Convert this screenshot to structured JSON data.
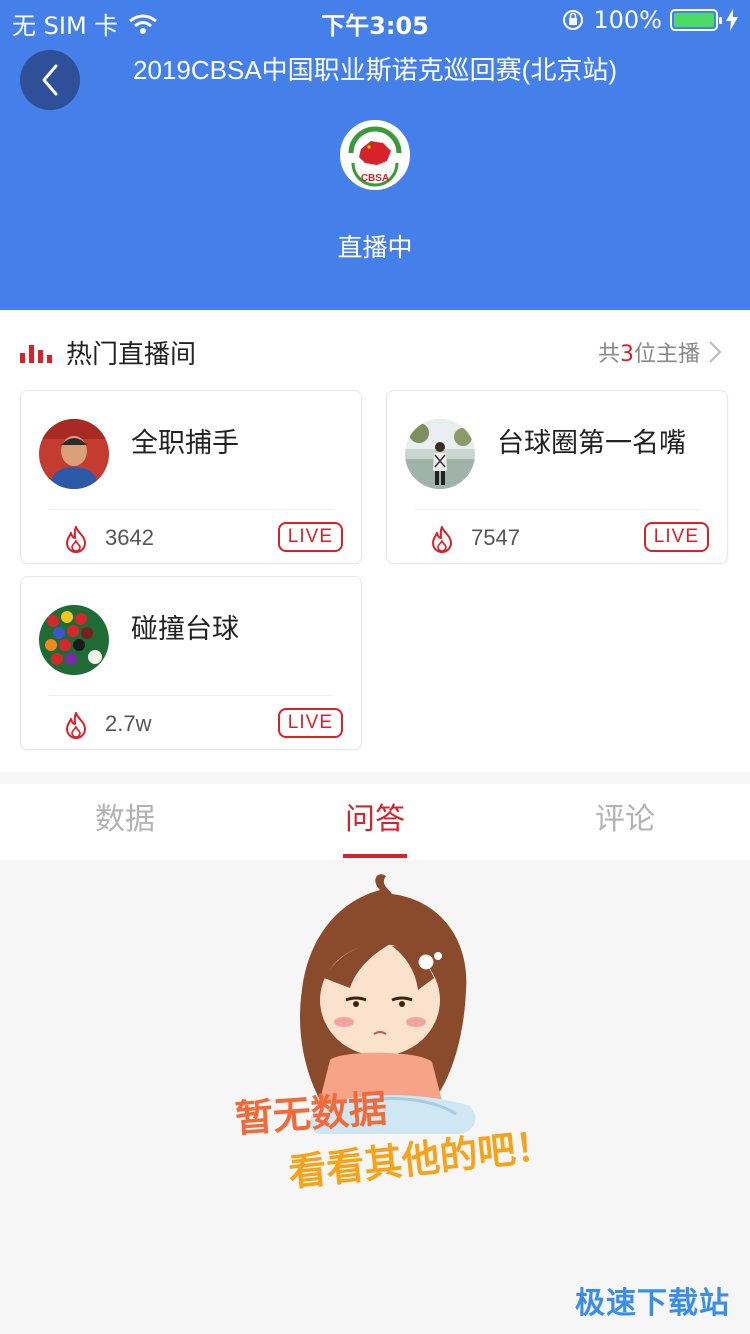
{
  "status_bar": {
    "carrier": "无 SIM 卡",
    "time": "下午3:05",
    "battery": "100%"
  },
  "header": {
    "event_title": "2019CBSA中国职业斯诺克巡回赛(北京站)",
    "logo_text": "CBSA",
    "live_status": "直播中",
    "bg_color": "#4580ea"
  },
  "hot_rooms": {
    "title": "热门直播间",
    "host_count_prefix": "共",
    "host_count": "3",
    "host_count_suffix": "位主播",
    "items": [
      {
        "name": "全职捕手",
        "count": "3642",
        "badge": "LIVE"
      },
      {
        "name": "台球圈第一名嘴",
        "count": "7547",
        "badge": "LIVE"
      },
      {
        "name": "碰撞台球",
        "count": "2.7w",
        "badge": "LIVE"
      }
    ]
  },
  "tabs": [
    {
      "label": "数据",
      "active": false
    },
    {
      "label": "问答",
      "active": true
    },
    {
      "label": "评论",
      "active": false
    }
  ],
  "empty_state": {
    "line1": "暂无数据",
    "line2": "看看其他的吧！"
  },
  "watermark": "极速下载站",
  "colors": {
    "accent": "#d8222b",
    "header_blue": "#4580ea"
  }
}
